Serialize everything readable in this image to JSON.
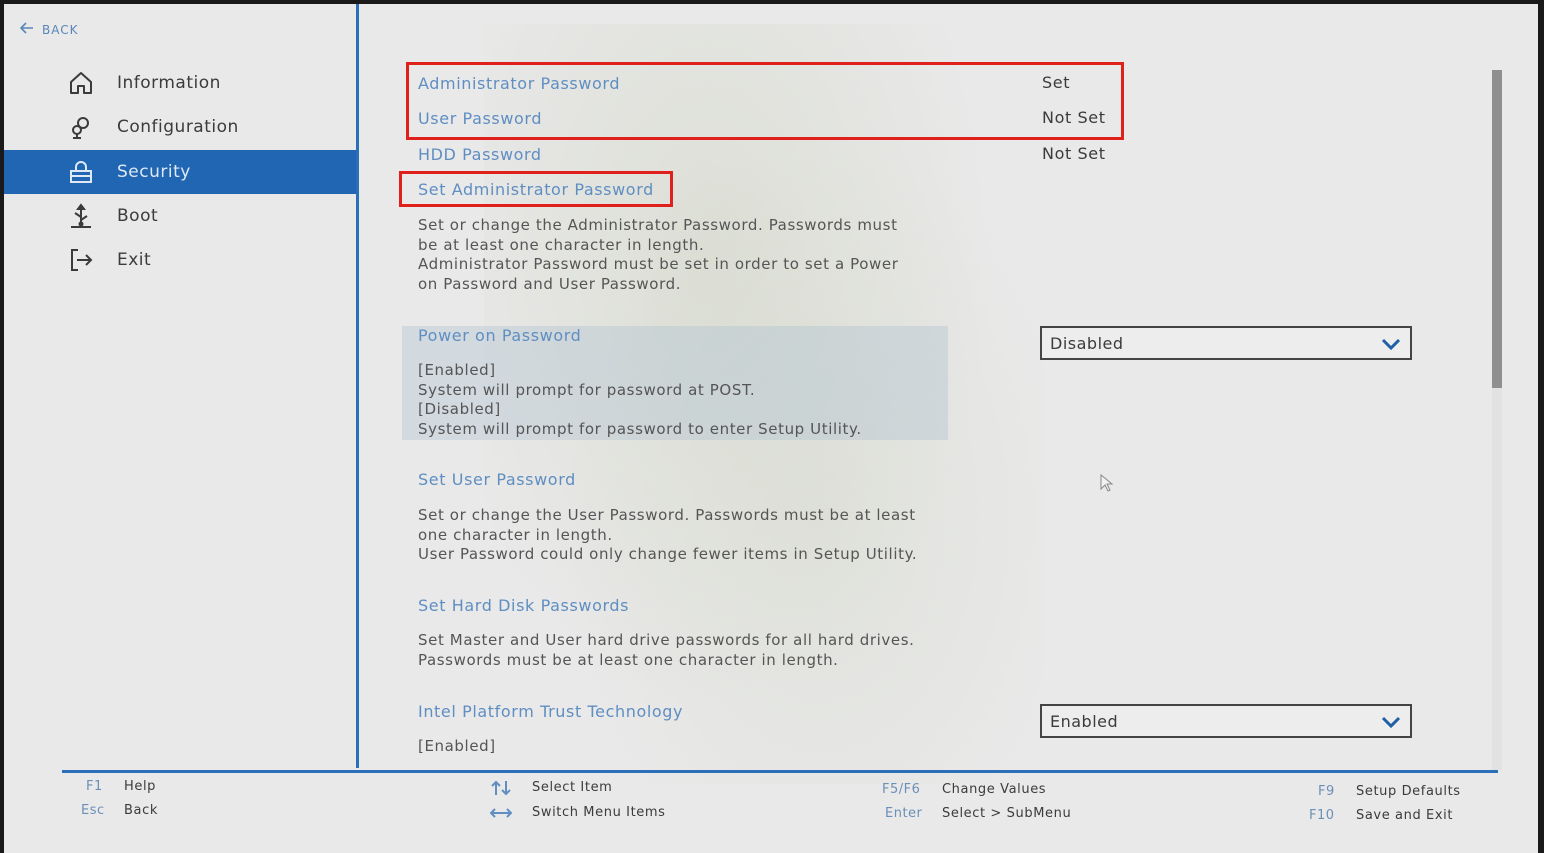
{
  "colors": {
    "accent_blue": "#2166b3",
    "link_blue": "#5f8ec2",
    "highlight_red": "#e0201a",
    "background": "#e9e9e9"
  },
  "back": {
    "label": "BACK",
    "icon": "arrow-left-icon"
  },
  "sidebar": {
    "items": [
      {
        "label": "Information",
        "icon": "home-icon",
        "active": false
      },
      {
        "label": "Configuration",
        "icon": "gears-icon",
        "active": false
      },
      {
        "label": "Security",
        "icon": "lock-icon",
        "active": true
      },
      {
        "label": "Boot",
        "icon": "usb-icon",
        "active": false
      },
      {
        "label": "Exit",
        "icon": "exit-icon",
        "active": false
      }
    ]
  },
  "main": {
    "status_rows": [
      {
        "label": "Administrator Password",
        "value": "Set"
      },
      {
        "label": "User Password",
        "value": "Not Set"
      },
      {
        "label": "HDD Password",
        "value": "Not Set"
      }
    ],
    "set_admin": {
      "title": "Set Administrator Password",
      "desc": "Set or change the Administrator Password. Passwords must\nbe at least one character in length.\nAdministrator Password must be set in order to set a Power\non Password and User Password."
    },
    "power_on": {
      "title": "Power on Password",
      "desc": "[Enabled]\nSystem will prompt for password at POST.\n[Disabled]\nSystem will prompt for password to enter Setup Utility.",
      "selected": "Disabled"
    },
    "set_user": {
      "title": "Set User Password",
      "desc": "Set or change the User Password. Passwords must be at least\none character in length.\nUser Password could only change fewer items in Setup Utility."
    },
    "set_hdd": {
      "title": "Set Hard Disk Passwords",
      "desc": "Set Master and User hard drive passwords for all hard drives.\nPasswords must be at least one character in length."
    },
    "ptt": {
      "title": "Intel Platform Trust Technology",
      "desc": "[Enabled]",
      "selected": "Enabled"
    }
  },
  "footer": {
    "f1_key": "F1",
    "f1_label": "Help",
    "esc_key": "Esc",
    "esc_label": "Back",
    "select_item": "Select Item",
    "switch_menu": "Switch Menu Items",
    "f5f6_key": "F5/F6",
    "f5f6_label": "Change Values",
    "enter_key": "Enter",
    "enter_label": "Select > SubMenu",
    "f9_key": "F9",
    "f9_label": "Setup Defaults",
    "f10_key": "F10",
    "f10_label": "Save and Exit"
  }
}
